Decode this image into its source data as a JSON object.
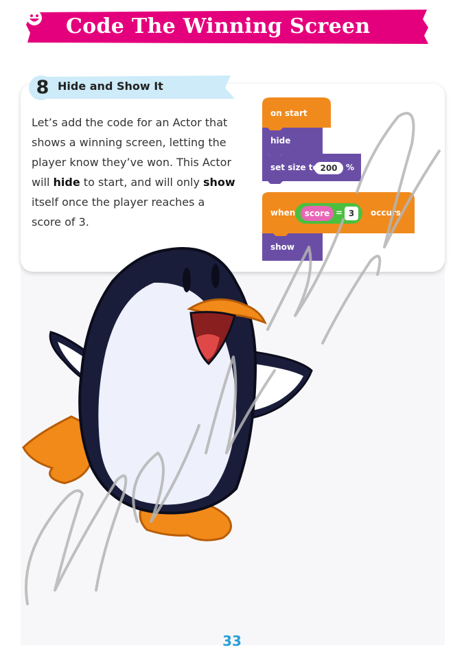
{
  "header": {
    "title": "Code The Winning Screen",
    "icon": "smiley-icon",
    "color": "#e4007c"
  },
  "step": {
    "number": "8",
    "title": "Hide and Show It",
    "tab_color": "#cdebf8",
    "text_parts": [
      "Let’s add the code for an Actor that shows a winning screen, letting the player know they’ve won. This Actor will ",
      "hide",
      " to start, and will only ",
      "show",
      " itself once the player reaches a score of 3."
    ]
  },
  "code_blocks": {
    "on_start": "on start",
    "hide": "hide",
    "set_size": "set size to",
    "size_value": "200",
    "percent": "%",
    "when": "when",
    "score": "score",
    "equals": "=",
    "compare_value": "3",
    "occurs": "occurs",
    "show": "show",
    "colors": {
      "event": "#f08a1c",
      "looks": "#6a4ea6",
      "variable": "#e866b6",
      "operator": "#4cbf3f"
    }
  },
  "illustration": "penguin",
  "watermark_text": "Malijoushi Patel",
  "page_number": "33"
}
